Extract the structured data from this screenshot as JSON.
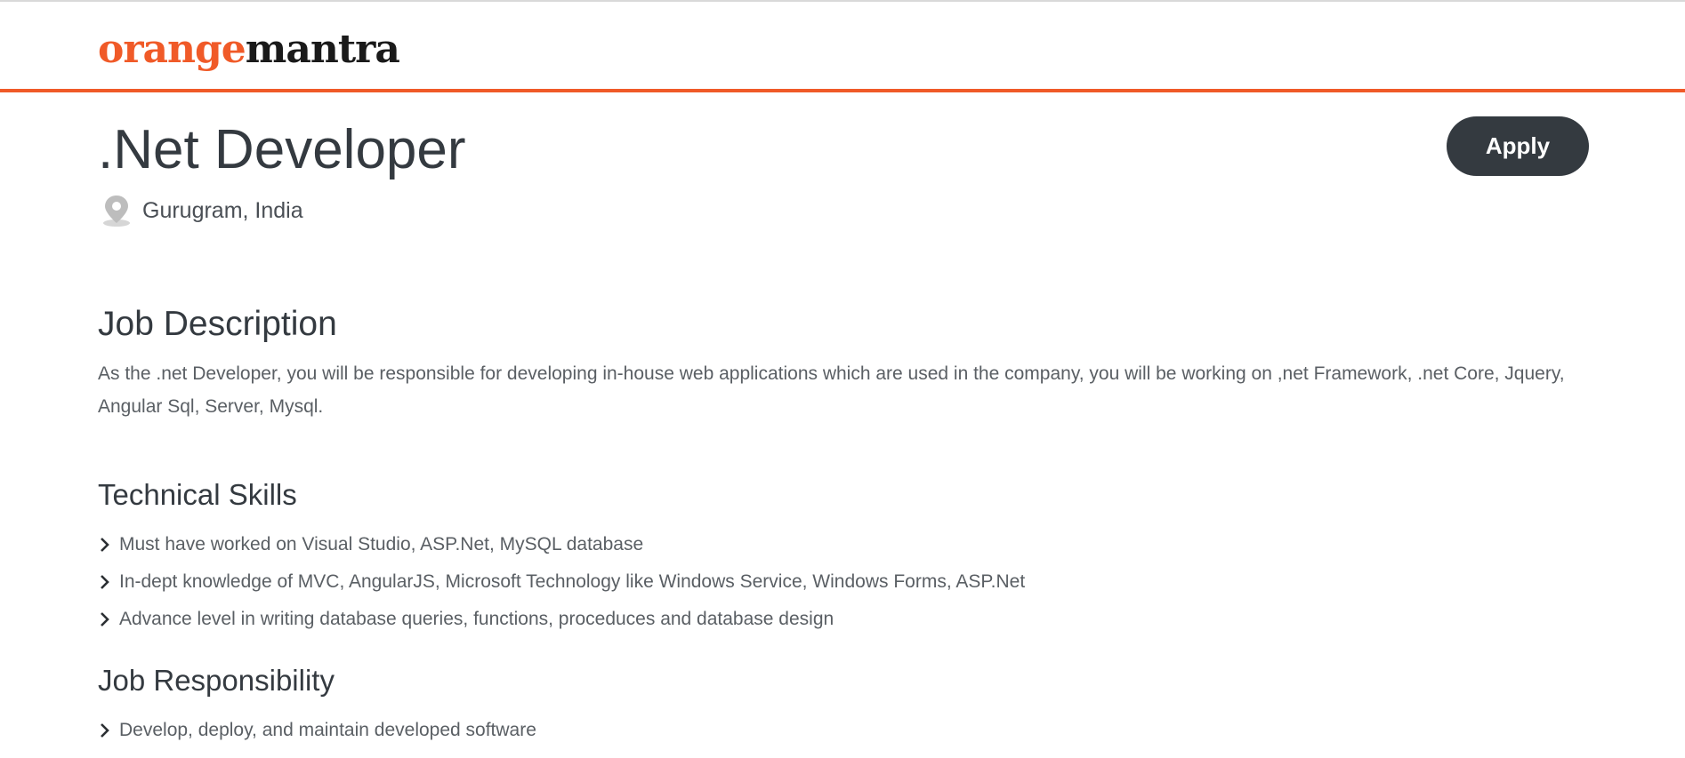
{
  "header": {
    "logo_part_a": "orange",
    "logo_part_b": "mantra",
    "accent_color": "#f05a28"
  },
  "job": {
    "title": ".Net Developer",
    "apply_label": "Apply",
    "location_icon": "map-pin-icon",
    "location": "Gurugram, India"
  },
  "description": {
    "heading": "Job Description",
    "text": "As the .net Developer, you will be responsible for developing in-house web applications which are used in the company, you will be working on ,net Framework, .net Core, Jquery, Angular Sql, Server, Mysql."
  },
  "technical_skills": {
    "heading": "Technical Skills",
    "bullet_icon": "chevron-right-icon",
    "items": [
      "Must have worked on Visual Studio, ASP.Net, MySQL database",
      "In-dept knowledge of MVC, AngularJS, Microsoft Technology like Windows Service, Windows Forms, ASP.Net",
      "Advance level in writing database queries, functions, proceduces and database design"
    ]
  },
  "responsibility": {
    "heading": "Job Responsibility",
    "items": [
      "Develop, deploy, and maintain developed software"
    ]
  },
  "colors": {
    "button_bg": "#343a40",
    "text": "#343a40"
  }
}
